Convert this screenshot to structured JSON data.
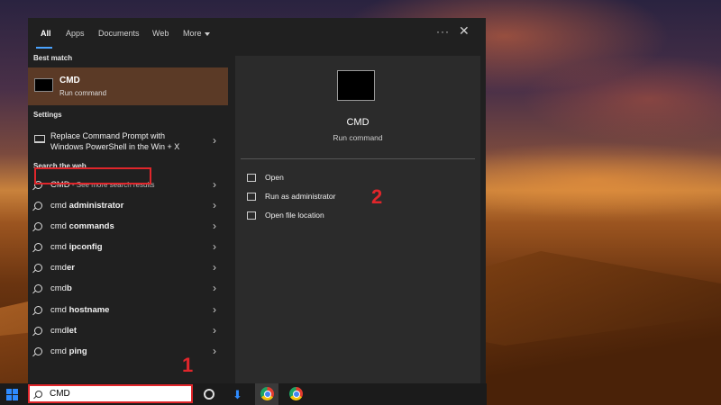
{
  "tabs": [
    {
      "label": "All"
    },
    {
      "label": "Apps"
    },
    {
      "label": "Documents"
    },
    {
      "label": "Web"
    },
    {
      "label": "More"
    }
  ],
  "header_more_glyph": "···",
  "close_glyph": "✕",
  "sections": {
    "best_match": "Best match",
    "settings": "Settings",
    "search_web": "Search the web"
  },
  "best_match": {
    "title": "CMD",
    "subtitle": "Run command"
  },
  "settings_item": {
    "line1": "Replace Command Prompt with",
    "line2": "Windows PowerShell in the Win + X"
  },
  "web_results": [
    {
      "prefix": "CMD",
      "bold": "",
      "sub": " - See more search results"
    },
    {
      "prefix": "cmd ",
      "bold": "administrator",
      "sub": ""
    },
    {
      "prefix": "cmd ",
      "bold": "commands",
      "sub": ""
    },
    {
      "prefix": "cmd ",
      "bold": "ipconfig",
      "sub": ""
    },
    {
      "prefix": "cmd",
      "bold": "er",
      "sub": ""
    },
    {
      "prefix": "cmd",
      "bold": "b",
      "sub": ""
    },
    {
      "prefix": "cmd ",
      "bold": "hostname",
      "sub": ""
    },
    {
      "prefix": "cmd",
      "bold": "let",
      "sub": ""
    },
    {
      "prefix": "cmd ",
      "bold": "ping",
      "sub": ""
    }
  ],
  "chevron": "›",
  "preview": {
    "title": "CMD",
    "subtitle": "Run command",
    "actions": [
      {
        "label": "Open"
      },
      {
        "label": "Run as administrator"
      },
      {
        "label": "Open file location"
      }
    ]
  },
  "annotations": {
    "step1": "1",
    "step2": "2"
  },
  "taskbar": {
    "search_value": "CMD",
    "download_glyph": "⬇"
  },
  "colors": {
    "accent": "#4aa3ff",
    "highlight_red": "#e0262b",
    "best_match_bg": "#5b3a26"
  }
}
